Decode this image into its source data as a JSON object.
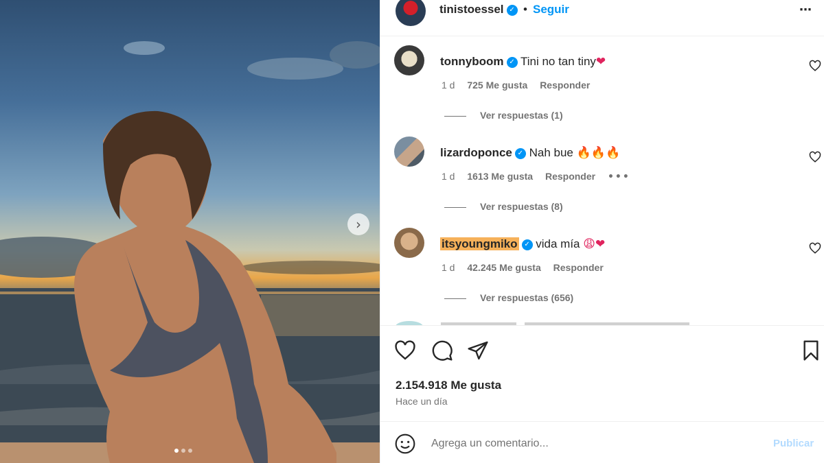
{
  "header": {
    "username": "tinistoessel",
    "separator": "•",
    "follow_label": "Seguir",
    "more_icon": "⋯"
  },
  "photo": {
    "carousel_total": 3,
    "carousel_active": 1,
    "next_icon": "›"
  },
  "comments": [
    {
      "username": "tonnyboom",
      "verified": true,
      "text": "Tini no tan tiny",
      "emojis": "❤",
      "time": "1 d",
      "likes": "725 Me gusta",
      "reply_label": "Responder",
      "replies_label": "Ver respuestas (1)"
    },
    {
      "username": "lizardoponce",
      "verified": true,
      "text": "Nah bue",
      "emojis": "🔥🔥🔥",
      "time": "1 d",
      "likes": "1613 Me gusta",
      "reply_label": "Responder",
      "options": "•••",
      "replies_label": "Ver respuestas (8)"
    },
    {
      "username": "itsyoungmiko",
      "verified": true,
      "highlighted": true,
      "text": "vida mía",
      "emojis": "😩❤",
      "time": "1 d",
      "likes": "42.245 Me gusta",
      "reply_label": "Responder",
      "replies_label": "Ver respuestas (656)"
    }
  ],
  "actions": {
    "like_icon": "heart-icon",
    "comment_icon": "comment-icon",
    "share_icon": "send-icon",
    "save_icon": "bookmark-icon"
  },
  "stats": {
    "likes": "2.154.918 Me gusta",
    "posted": "Hace un día"
  },
  "composer": {
    "placeholder": "Agrega un comentario...",
    "value": "",
    "publish_label": "Publicar"
  },
  "colors": {
    "accent": "#0095f6",
    "verified": "#0095f6",
    "highlight": "#f6b15a",
    "publish_disabled": "#b3dbff",
    "muted": "#737373"
  }
}
